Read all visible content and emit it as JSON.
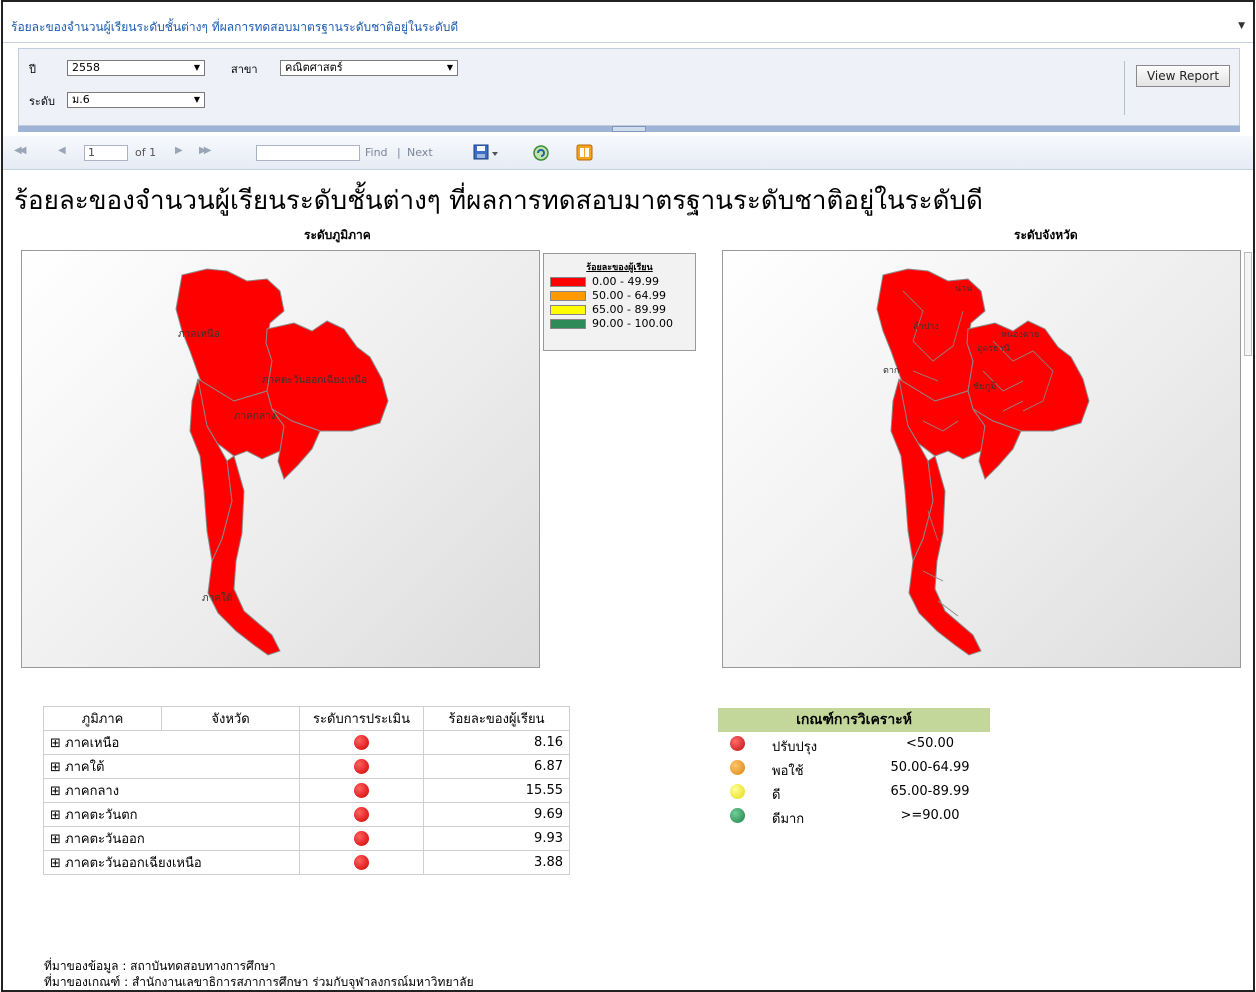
{
  "window": {
    "title": "ร้อยละของจำนวนผู้เรียนระดับชั้นต่างๆ ที่ผลการทดสอบมาตรฐานระดับชาติอยู่ในระดับดี",
    "menu_arrow": "▼"
  },
  "params": {
    "year_label": "ปี",
    "year_value": "2558",
    "subject_label": "สาขา",
    "subject_value": "คณิตศาสตร์",
    "level_label": "ระดับ",
    "level_value": "ม.6",
    "view_report": "View Report"
  },
  "toolbar": {
    "first": "◀◀",
    "prev": "◀",
    "page": "1",
    "of": "of 1",
    "next": "▶",
    "last": "▶▶",
    "find": "Find",
    "sep": "|",
    "next_find": "Next",
    "icons": [
      "first-page-icon",
      "prev-page-icon",
      "next-page-icon",
      "last-page-icon",
      "export-icon",
      "refresh-icon",
      "print-icon"
    ]
  },
  "report": {
    "title": "ร้อยละของจำนวนผู้เรียนระดับชั้นต่างๆ ที่ผลการทดสอบมาตรฐานระดับชาติอยู่ในระดับดี",
    "map_left_title": "ระดับภูมิภาค",
    "map_right_title": "ระดับจังหวัด",
    "region_labels": [
      "ภาคเหนือ",
      "ภาคตะวันออกเฉียงเหนือ",
      "ภาคกลาง",
      "ภาคใต้"
    ],
    "province_labels": [
      "น่าน",
      "ลำปาง",
      "หนองคาย",
      "อุดรธานี",
      "ตาก",
      "ชัยภูมิ"
    ],
    "legend": {
      "title": "ร้อยละของผู้เรียน",
      "items": [
        {
          "label": "0.00 - 49.99",
          "color": "#ff0000"
        },
        {
          "label": "50.00 - 64.99",
          "color": "#ff9900"
        },
        {
          "label": "65.00 - 89.99",
          "color": "#ffff00"
        },
        {
          "label": "90.00 - 100.00",
          "color": "#2e8b57"
        }
      ]
    },
    "table": {
      "headers": [
        "ภูมิภาค",
        "จังหวัด",
        "ระดับการประเมิน",
        "ร้อยละของผู้เรียน"
      ],
      "rows": [
        {
          "region": "⊞ ภาคเหนือ",
          "value": "8.16",
          "status_color": "#e00000"
        },
        {
          "region": "⊞ ภาคใต้",
          "value": "6.87",
          "status_color": "#e00000"
        },
        {
          "region": "⊞ ภาคกลาง",
          "value": "15.55",
          "status_color": "#e00000"
        },
        {
          "region": "⊞ ภาคตะวันตก",
          "value": "9.69",
          "status_color": "#e00000"
        },
        {
          "region": "⊞ ภาคตะวันออก",
          "value": "9.93",
          "status_color": "#e00000"
        },
        {
          "region": "⊞ ภาคตะวันออกเฉียงเหนือ",
          "value": "3.88",
          "status_color": "#e00000"
        }
      ]
    },
    "criteria": {
      "title": "เกณฑ์การวิเคราะห์",
      "items": [
        {
          "label": "ปรับปรุง",
          "range": "<50.00",
          "color": "#d81b1b"
        },
        {
          "label": "พอใช้",
          "range": "50.00-64.99",
          "color": "#e89a1c"
        },
        {
          "label": "ดี",
          "range": "65.00-89.99",
          "color": "#f2e81a"
        },
        {
          "label": "ดีมาก",
          "range": ">=90.00",
          "color": "#2e9a5c"
        }
      ]
    },
    "source_data": "ที่มาของข้อมูล : สถาบันทดสอบทางการศึกษา",
    "source_criteria": "ที่มาของเกณฑ์ : สำนักงานเลขาธิการสภาการศึกษา ร่วมกับจุฬาลงกรณ์มหาวิทยาลัย"
  }
}
